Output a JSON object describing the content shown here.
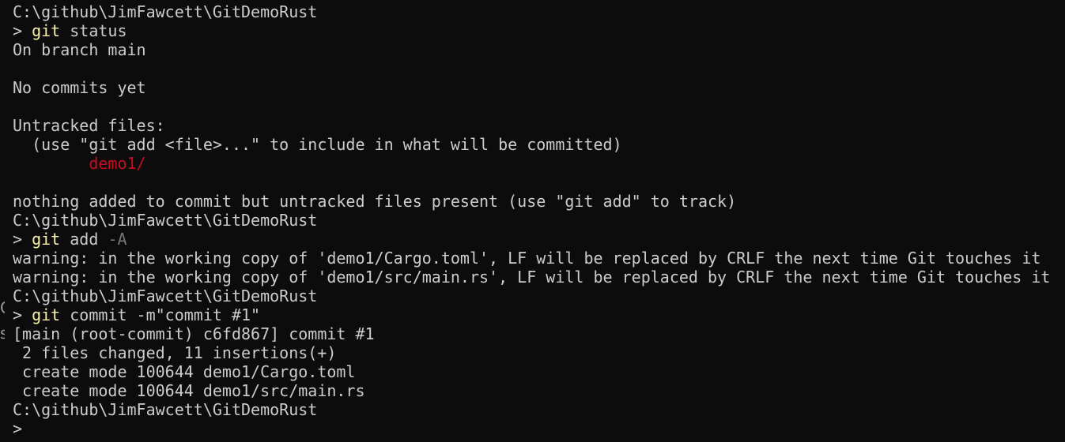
{
  "terminal": {
    "lines": [
      {
        "type": "path",
        "text": "C:\\github\\JimFawcett\\GitDemoRust"
      },
      {
        "type": "command",
        "prompt": "> ",
        "cmd": "git",
        "args": " status",
        "flag": ""
      },
      {
        "type": "output",
        "text": "On branch main"
      },
      {
        "type": "blank",
        "text": ""
      },
      {
        "type": "output",
        "text": "No commits yet"
      },
      {
        "type": "blank",
        "text": ""
      },
      {
        "type": "output",
        "text": "Untracked files:"
      },
      {
        "type": "output",
        "text": "  (use \"git add <file>...\" to include in what will be committed)"
      },
      {
        "type": "untracked",
        "indent": "        ",
        "text": "demo1/"
      },
      {
        "type": "blank",
        "text": ""
      },
      {
        "type": "output",
        "text": "nothing added to commit but untracked files present (use \"git add\" to track)"
      },
      {
        "type": "path",
        "text": "C:\\github\\JimFawcett\\GitDemoRust"
      },
      {
        "type": "command",
        "prompt": "> ",
        "cmd": "git",
        "args": " add ",
        "flag": "-A"
      },
      {
        "type": "output",
        "text": "warning: in the working copy of 'demo1/Cargo.toml', LF will be replaced by CRLF the next time Git touches it"
      },
      {
        "type": "output",
        "text": "warning: in the working copy of 'demo1/src/main.rs', LF will be replaced by CRLF the next time Git touches it"
      },
      {
        "type": "path",
        "text": "C:\\github\\JimFawcett\\GitDemoRust"
      },
      {
        "type": "command",
        "prompt": "> ",
        "cmd": "git",
        "args": " commit -m\"commit #1\"",
        "flag": ""
      },
      {
        "type": "output",
        "text": "[main (root-commit) c6fd867] commit #1"
      },
      {
        "type": "output",
        "text": " 2 files changed, 11 insertions(+)"
      },
      {
        "type": "output",
        "text": " create mode 100644 demo1/Cargo.toml"
      },
      {
        "type": "output",
        "text": " create mode 100644 demo1/src/main.rs"
      },
      {
        "type": "path",
        "text": "C:\\github\\JimFawcett\\GitDemoRust"
      },
      {
        "type": "prompt",
        "prompt": ">"
      }
    ]
  },
  "colors": {
    "background": "#0c0c0c",
    "foreground": "#cccccc",
    "command": "#f9f1a5",
    "flag": "#767676",
    "untracked": "#c50f1f"
  }
}
